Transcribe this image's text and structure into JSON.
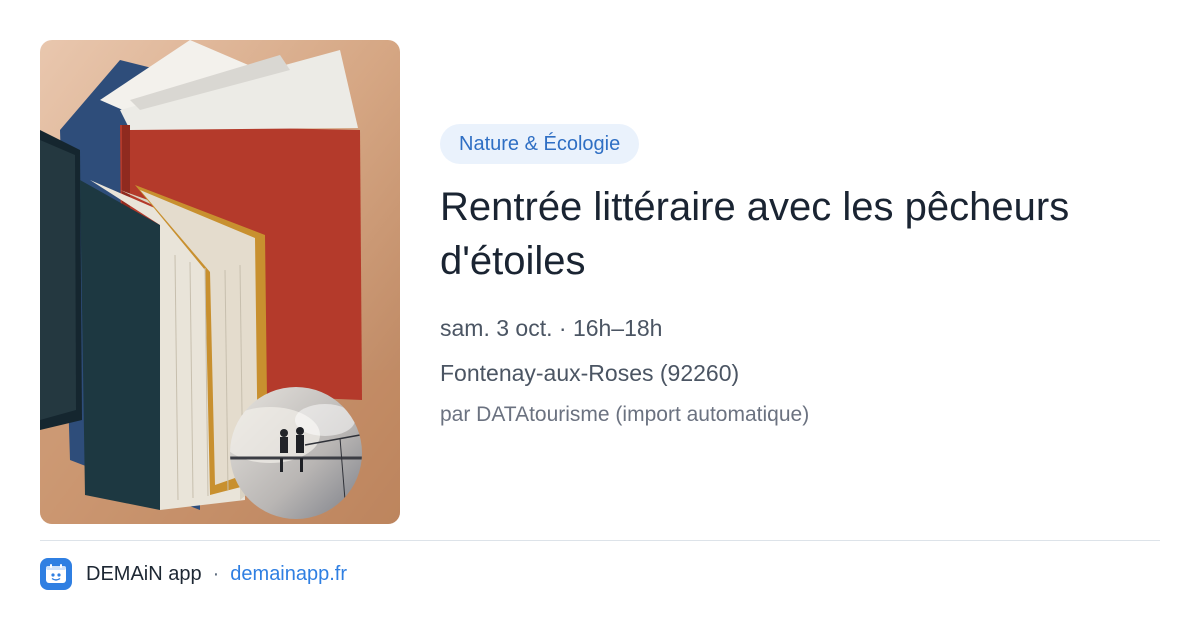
{
  "hero": {
    "image": "books-photo-with-moon-fishermen-vignette"
  },
  "event": {
    "category": "Nature & Écologie",
    "title": "Rentrée littéraire avec les pêcheurs d'étoiles",
    "date": "sam. 3 oct.",
    "time": "16h–18h",
    "location": "Fontenay-aux-Roses (92260)",
    "source": "par DATAtourisme (import automatique)"
  },
  "footer": {
    "logo_icon": "demain-logo-icon",
    "app_name": "DEMAiN app",
    "separator": "·",
    "url": "demainapp.fr"
  },
  "colors": {
    "accent": "#2f7fe2",
    "badge_bg": "#eaf2fc",
    "badge_text": "#2f6fc4"
  }
}
